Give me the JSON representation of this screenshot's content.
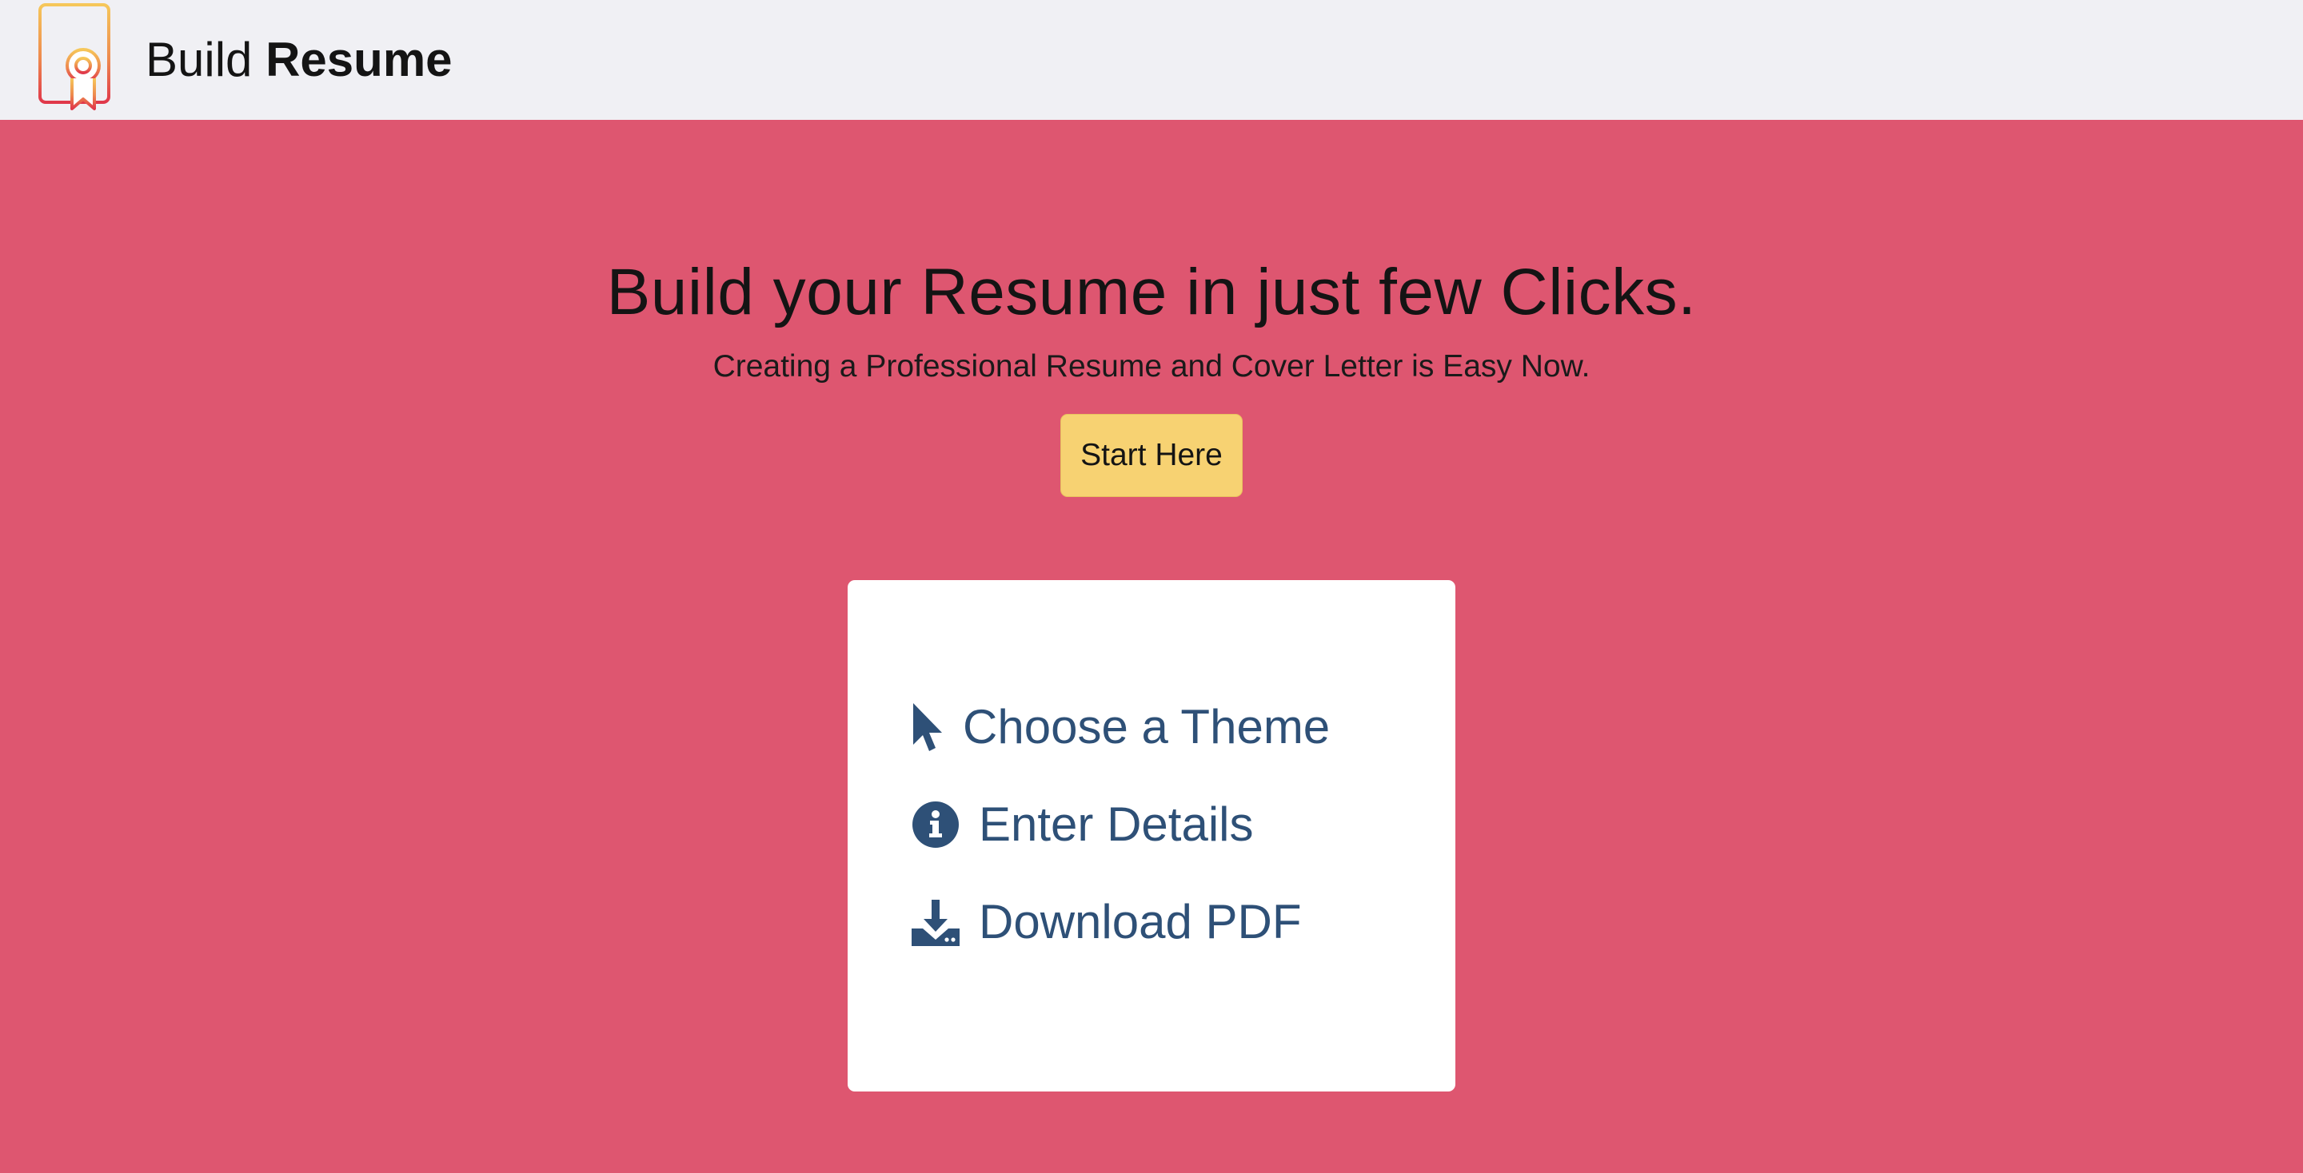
{
  "navbar": {
    "brand_light": "Build ",
    "brand_bold": "Resume",
    "logo_icon": "resume-certificate-icon"
  },
  "hero": {
    "title": "Build your Resume in just few Clicks.",
    "subtitle": "Creating a Professional Resume and Cover Letter is Easy Now.",
    "cta_label": "Start Here"
  },
  "steps": [
    {
      "icon": "cursor-pointer-icon",
      "label": "Choose a Theme"
    },
    {
      "icon": "info-circle-icon",
      "label": "Enter Details"
    },
    {
      "icon": "download-icon",
      "label": "Download PDF"
    }
  ],
  "colors": {
    "navbar_bg": "#f0f0f4",
    "page_bg": "#de5670",
    "button_bg": "#f7d272",
    "card_bg": "#ffffff",
    "step_text": "#2e5077"
  }
}
